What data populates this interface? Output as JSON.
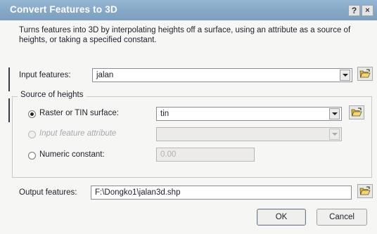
{
  "window": {
    "title": "Convert Features to 3D",
    "help_label": "?",
    "close_label": "×"
  },
  "description": "Turns features into 3D by interpolating heights off a surface, using an attribute as a source of heights, or taking a specified constant.",
  "input_features": {
    "label": "Input features:",
    "value": "jalan"
  },
  "source_of_heights": {
    "title": "Source of heights",
    "options": [
      {
        "label": "Raster or TIN surface:",
        "selected": true,
        "enabled": true,
        "value": "tin"
      },
      {
        "label": "Input feature attribute",
        "selected": false,
        "enabled": false,
        "value": ""
      },
      {
        "label": "Numeric constant:",
        "selected": false,
        "enabled": true,
        "value": "0.00"
      }
    ]
  },
  "output_features": {
    "label": "Output features:",
    "value": "F:\\Dongko1\\jalan3d.shp"
  },
  "buttons": {
    "ok": "OK",
    "cancel": "Cancel"
  },
  "icons": {
    "browse": "open-folder-icon",
    "dropdown": "chevron-down-icon"
  },
  "colors": {
    "titlebar": "#86a8c7",
    "dialog_bg": "#f6f6f4"
  }
}
